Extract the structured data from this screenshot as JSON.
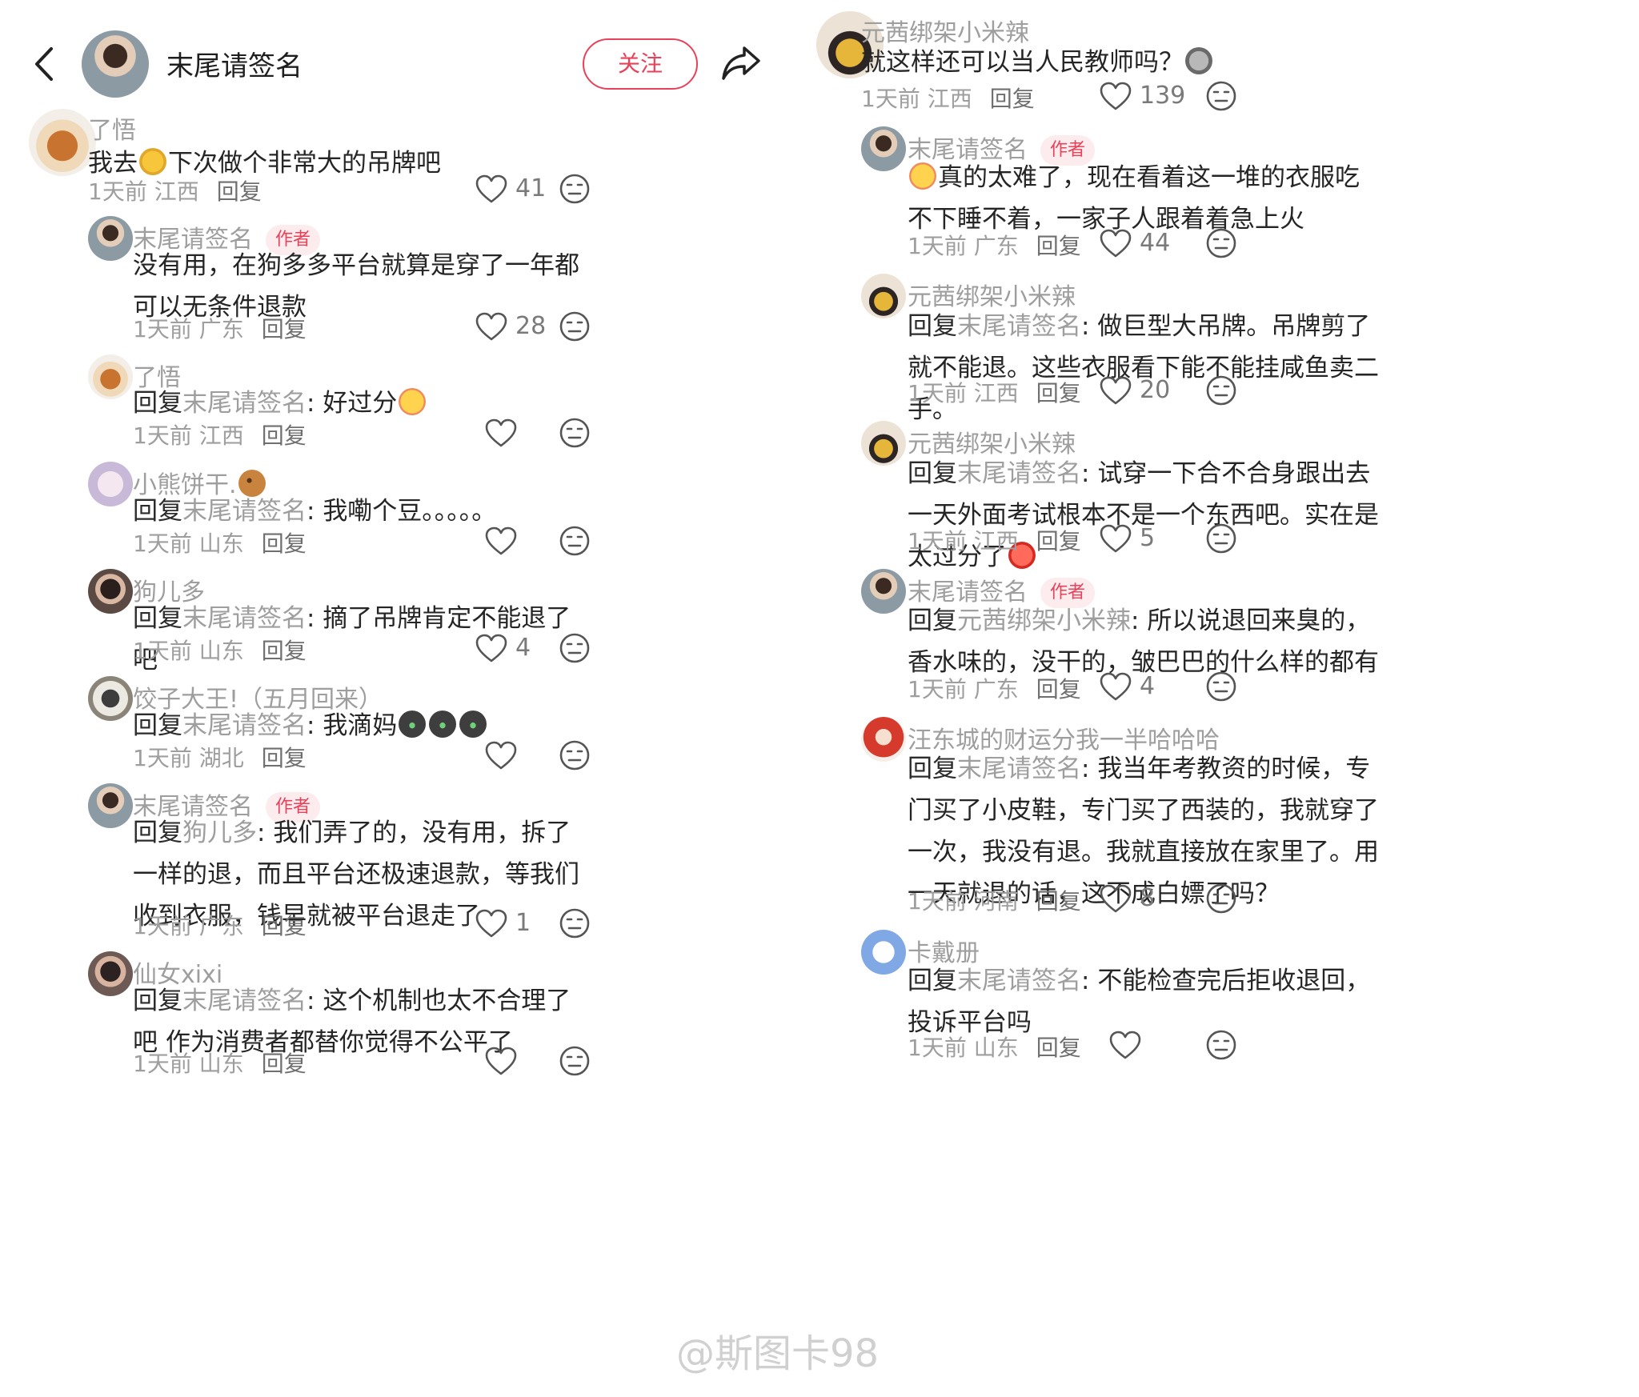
{
  "header": {
    "name": "末尾请签名",
    "follow_label": "关注"
  },
  "author_badge": "作者",
  "reply_word": "回复",
  "comments_left": [
    {
      "user": "了悟",
      "text": "我去",
      "text2": "下次做个非常大的吊牌吧",
      "time": "1天前",
      "location": "江西",
      "likes": "41"
    },
    {
      "user": "末尾请签名",
      "author": true,
      "text": "没有用，在狗多多平台就算是穿了一年都可以无条件退款",
      "time": "1天前",
      "location": "广东",
      "likes": "28"
    },
    {
      "user": "了悟",
      "reply_to": "末尾请签名",
      "text": "好过分",
      "time": "1天前",
      "location": "江西",
      "likes": ""
    },
    {
      "user": "小熊饼干.",
      "reply_to": "末尾请签名",
      "text": "我嘞个豆。。。。。",
      "time": "1天前",
      "location": "山东",
      "likes": ""
    },
    {
      "user": "狗儿多",
      "reply_to": "末尾请签名",
      "text": "摘了吊牌肯定不能退了吧",
      "time": "1天前",
      "location": "山东",
      "likes": "4"
    },
    {
      "user": "饺子大王!（五月回来）",
      "reply_to": "末尾请签名",
      "text": "我滴妈",
      "time": "1天前",
      "location": "湖北",
      "likes": ""
    },
    {
      "user": "末尾请签名",
      "author": true,
      "reply_to": "狗儿多",
      "text": "我们弄了的，没有用，拆了一样的退，而且平台还极速退款，等我们收到衣服，钱早就被平台退走了",
      "time": "1天前",
      "location": "广东",
      "likes": "1"
    },
    {
      "user": "仙女xixi",
      "reply_to": "末尾请签名",
      "text": "这个机制也太不合理了吧 作为消费者都替你觉得不公平了",
      "time": "1天前",
      "location": "山东",
      "likes": ""
    }
  ],
  "comments_right": [
    {
      "user": "元茜绑架小米辣",
      "text": "就这样还可以当人民教师吗？",
      "time": "1天前",
      "location": "江西",
      "likes": "139"
    },
    {
      "user": "末尾请签名",
      "author": true,
      "text": "真的太难了，现在看着这一堆的衣服吃不下睡不着，一家子人跟着着急上火",
      "time": "1天前",
      "location": "广东",
      "likes": "44"
    },
    {
      "user": "元茜绑架小米辣",
      "reply_to": "末尾请签名",
      "text": "做巨型大吊牌。吊牌剪了就不能退。这些衣服看下能不能挂咸鱼卖二手。",
      "time": "1天前",
      "location": "江西",
      "likes": "20"
    },
    {
      "user": "元茜绑架小米辣",
      "reply_to": "末尾请签名",
      "text": "试穿一下合不合身跟出去一天外面考试根本不是一个东西吧。实在是太过分了",
      "time": "1天前",
      "location": "江西",
      "likes": "5"
    },
    {
      "user": "末尾请签名",
      "author": true,
      "reply_to": "元茜绑架小米辣",
      "text": "所以说退回来臭的，香水味的，没干的，皱巴巴的什么样的都有",
      "time": "1天前",
      "location": "广东",
      "likes": "4"
    },
    {
      "user": "汪东城的财运分我一半哈哈哈",
      "reply_to": "末尾请签名",
      "text": "我当年考教资的时候，专门买了小皮鞋，专门买了西装的，我就穿了一次，我没有退。我就直接放在家里了。用一天就退的话，这不成白嫖了吗？",
      "time": "1天前",
      "location": "河南",
      "likes": "8"
    },
    {
      "user": "卡戴册",
      "reply_to": "末尾请签名",
      "text": "不能检查完后拒收退回，投诉平台吗",
      "time": "1天前",
      "location": "山东",
      "likes": ""
    }
  ],
  "watermark": "@斯图卡98",
  "colors": {
    "accent": "#e8425a",
    "muted": "#9e9e9e",
    "text": "#252525"
  }
}
